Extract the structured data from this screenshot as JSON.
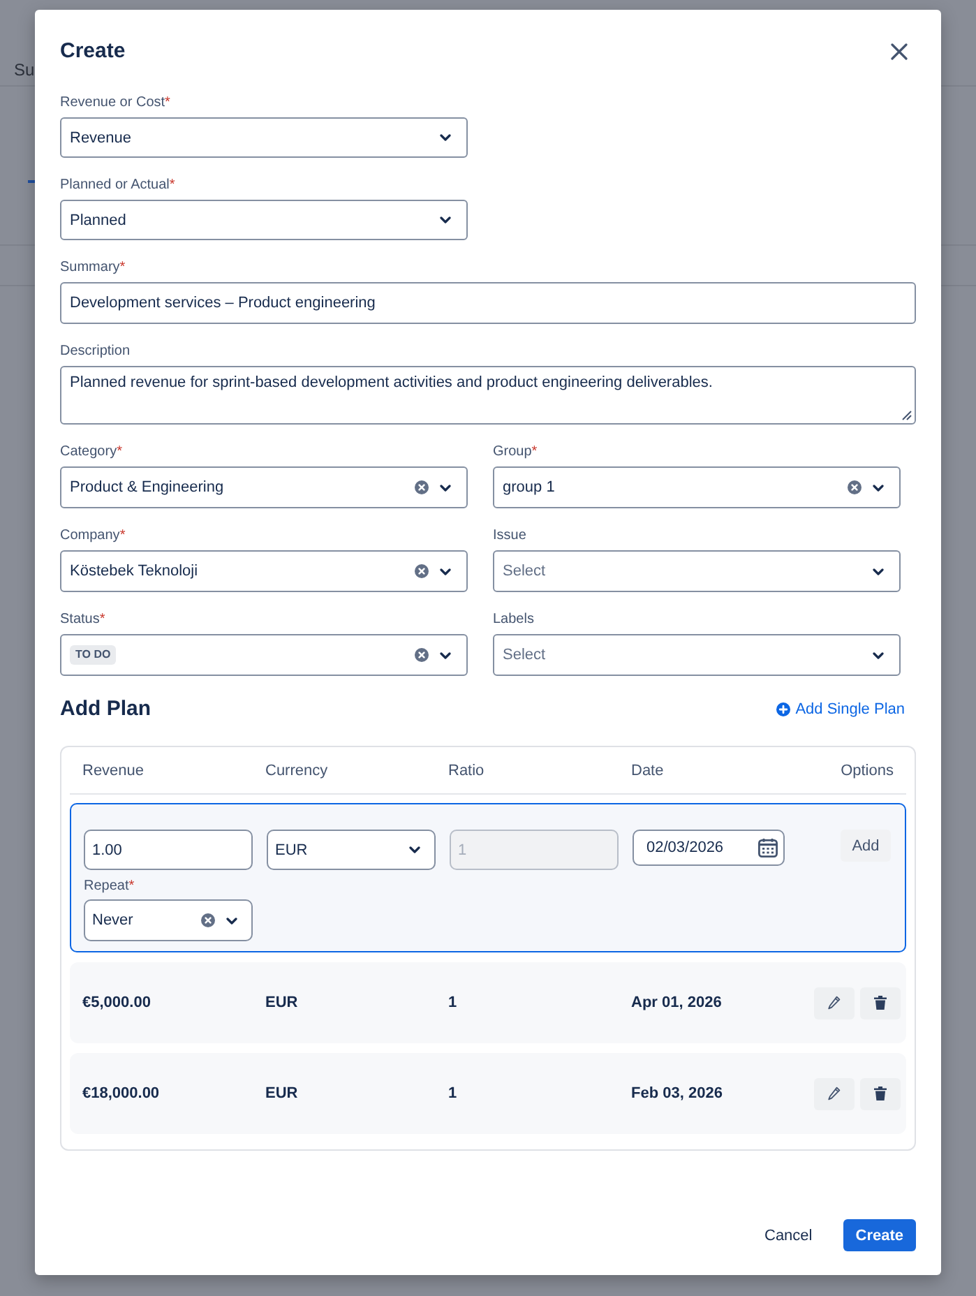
{
  "backdrop": {
    "tab_text": "Su"
  },
  "dialog": {
    "title": "Create"
  },
  "form": {
    "fields": [
      {
        "kind": "select",
        "label": "Revenue or Cost",
        "required_mark": "*",
        "value": "Revenue",
        "clearable": false
      },
      {
        "kind": "select",
        "label": "Planned or Actual",
        "required_mark": "*",
        "value": "Planned",
        "clearable": false
      },
      {
        "kind": "text",
        "label": "Summary",
        "required_mark": "*",
        "value": "Development services – Product engineering"
      },
      {
        "kind": "textarea",
        "label": "Description",
        "value": "Planned revenue for sprint-based development activities and product engineering deliverables."
      }
    ],
    "grid_fields": [
      {
        "kind": "select",
        "label": "Category",
        "required_mark": "*",
        "value": "Product & Engineering",
        "clearable": true
      },
      {
        "kind": "select",
        "label": "Group",
        "required_mark": "*",
        "value": "group 1",
        "clearable": true
      },
      {
        "kind": "select",
        "label": "Company",
        "required_mark": "*",
        "value": "Köstebek Teknoloji",
        "clearable": true
      },
      {
        "kind": "select",
        "label": "Issue",
        "placeholder": "Select",
        "clearable": false
      },
      {
        "kind": "select",
        "label": "Status",
        "required_mark": "*",
        "tag": "TO DO",
        "clearable": true
      },
      {
        "kind": "select",
        "label": "Labels",
        "placeholder": "Select",
        "clearable": false
      }
    ]
  },
  "plan": {
    "title": "Add Plan",
    "add_link": "Add Single Plan",
    "columns": [
      "Revenue",
      "Currency",
      "Ratio",
      "Date",
      "Options"
    ],
    "editor": {
      "revenue": "1.00",
      "currency": "EUR",
      "ratio": "1",
      "ratio_disabled": true,
      "date": "02/03/2026",
      "add_button": "Add",
      "repeat": {
        "label": "Repeat",
        "required_mark": "*",
        "value": "Never",
        "clearable": true
      }
    },
    "rows": [
      {
        "revenue": "€5,000.00",
        "currency": "EUR",
        "ratio": "1",
        "date": "Apr 01, 2026"
      },
      {
        "revenue": "€18,000.00",
        "currency": "EUR",
        "ratio": "1",
        "date": "Feb 03, 2026"
      }
    ]
  },
  "footer": {
    "buttons": [
      {
        "kind": "secondary",
        "label": "Cancel"
      },
      {
        "kind": "primary",
        "label": "Create"
      }
    ]
  }
}
